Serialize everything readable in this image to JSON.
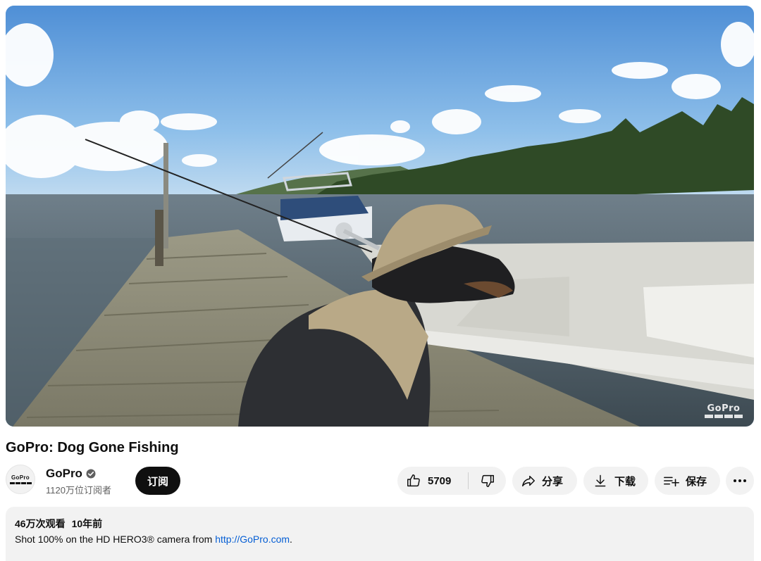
{
  "video": {
    "title": "GoPro: Dog Gone Fishing",
    "watermark": "GoPro"
  },
  "channel": {
    "name": "GoPro",
    "avatar_text": "GoPro",
    "subscribers": "1120万位订阅者",
    "verified_icon": "verified-check-icon"
  },
  "actions": {
    "subscribe_label": "订阅",
    "like_count": "5709",
    "share_label": "分享",
    "download_label": "下载",
    "save_label": "保存",
    "icons": {
      "like": "thumbs-up-icon",
      "dislike": "thumbs-down-icon",
      "share": "share-arrow-icon",
      "download": "download-icon",
      "save": "playlist-add-icon",
      "more": "more-horizontal-icon"
    }
  },
  "description": {
    "views": "46万次观看",
    "age": "10年前",
    "text_prefix": "Shot 100% on the HD HERO3® camera from ",
    "link_text": "http://GoPro.com",
    "text_suffix": "."
  },
  "colors": {
    "text_primary": "#0f0f0f",
    "text_secondary": "#606060",
    "pill_background": "#f2f2f2",
    "subscribe_background": "#0f0f0f",
    "link": "#065fd4"
  }
}
